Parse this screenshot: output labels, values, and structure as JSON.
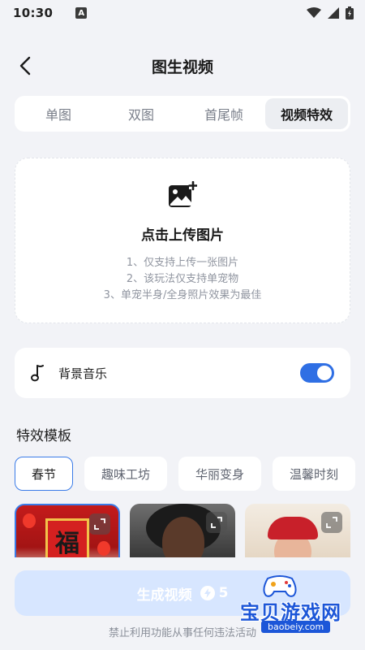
{
  "status_bar": {
    "time": "10:30",
    "notification_letter": "A"
  },
  "header": {
    "title": "图生视频",
    "back_icon": "chevron-left-icon"
  },
  "mode_tabs": [
    {
      "label": "单图",
      "active": false
    },
    {
      "label": "双图",
      "active": false
    },
    {
      "label": "首尾帧",
      "active": false
    },
    {
      "label": "视频特效",
      "active": true
    }
  ],
  "upload": {
    "icon": "image-add-icon",
    "title": "点击上传图片",
    "notes": [
      "1、仅支持上传一张图片",
      "2、该玩法仅支持单宠物",
      "3、单宠半身/全身照片效果为最佳"
    ]
  },
  "music": {
    "icon": "music-note-icon",
    "label": "背景音乐",
    "enabled": true
  },
  "templates": {
    "section_title": "特效模板",
    "tabs": [
      {
        "label": "春节",
        "active": true
      },
      {
        "label": "趣味工坊",
        "active": false
      },
      {
        "label": "华丽变身",
        "active": false
      },
      {
        "label": "温馨时刻",
        "active": false
      }
    ],
    "thumbnails": [
      {
        "name": "spring-festival-thumb",
        "caption": "福",
        "active": true
      },
      {
        "name": "portrait-thumb",
        "active": false
      },
      {
        "name": "costume-thumb",
        "active": false
      }
    ]
  },
  "generate": {
    "label": "生成视频",
    "cost": "5",
    "cost_icon": "lightning-icon"
  },
  "disclaimer": "禁止利用功能从事任何违法活动",
  "watermark": {
    "text": "宝贝游戏网",
    "url": "baobeiy.com"
  },
  "colors": {
    "accent": "#2f6fe4",
    "button_disabled": "#d7e6ff",
    "background": "#f2f3f7"
  }
}
